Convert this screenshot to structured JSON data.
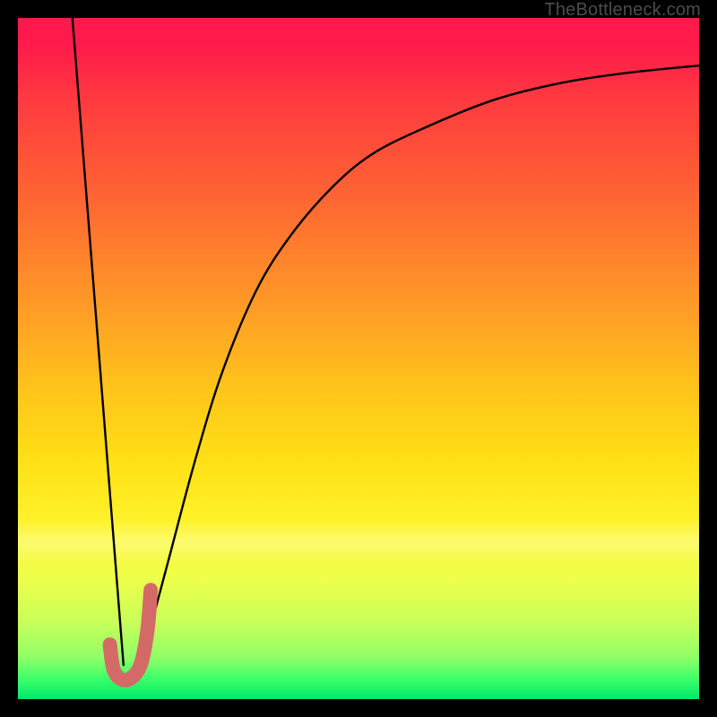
{
  "watermark": "TheBottleneck.com",
  "chart_data": {
    "type": "line",
    "title": "",
    "xlabel": "",
    "ylabel": "",
    "xlim": [
      0,
      100
    ],
    "ylim": [
      0,
      100
    ],
    "grid": false,
    "series": [
      {
        "name": "left-falling-line",
        "stroke": "#000000",
        "x": [
          8,
          15.5
        ],
        "y": [
          100,
          5
        ]
      },
      {
        "name": "right-rising-curve",
        "stroke": "#000000",
        "x": [
          18,
          22,
          26,
          30,
          35,
          40,
          46,
          52,
          60,
          70,
          80,
          90,
          100
        ],
        "y": [
          5,
          20,
          35,
          48,
          60,
          68,
          75,
          80,
          84,
          88,
          90.5,
          92,
          93
        ]
      },
      {
        "name": "j-mark",
        "stroke": "#d36a67",
        "x": [
          13.5,
          14,
          15,
          16.5,
          18,
          19,
          19.5
        ],
        "y": [
          8,
          4.5,
          3,
          3,
          5,
          10,
          16
        ]
      }
    ],
    "gradient_stops": [
      {
        "pos": 0.0,
        "color": "#ff1a4b"
      },
      {
        "pos": 0.04,
        "color": "#ff1a4b"
      },
      {
        "pos": 0.12,
        "color": "#ff3a3f"
      },
      {
        "pos": 0.28,
        "color": "#ff6a32"
      },
      {
        "pos": 0.42,
        "color": "#ff9a26"
      },
      {
        "pos": 0.55,
        "color": "#ffc61a"
      },
      {
        "pos": 0.65,
        "color": "#ffe015"
      },
      {
        "pos": 0.74,
        "color": "#fff22a"
      },
      {
        "pos": 0.82,
        "color": "#f0ff4a"
      },
      {
        "pos": 0.89,
        "color": "#c6ff5a"
      },
      {
        "pos": 0.94,
        "color": "#8eff68"
      },
      {
        "pos": 0.97,
        "color": "#3cff6a"
      },
      {
        "pos": 1.0,
        "color": "#00e96b"
      }
    ]
  }
}
